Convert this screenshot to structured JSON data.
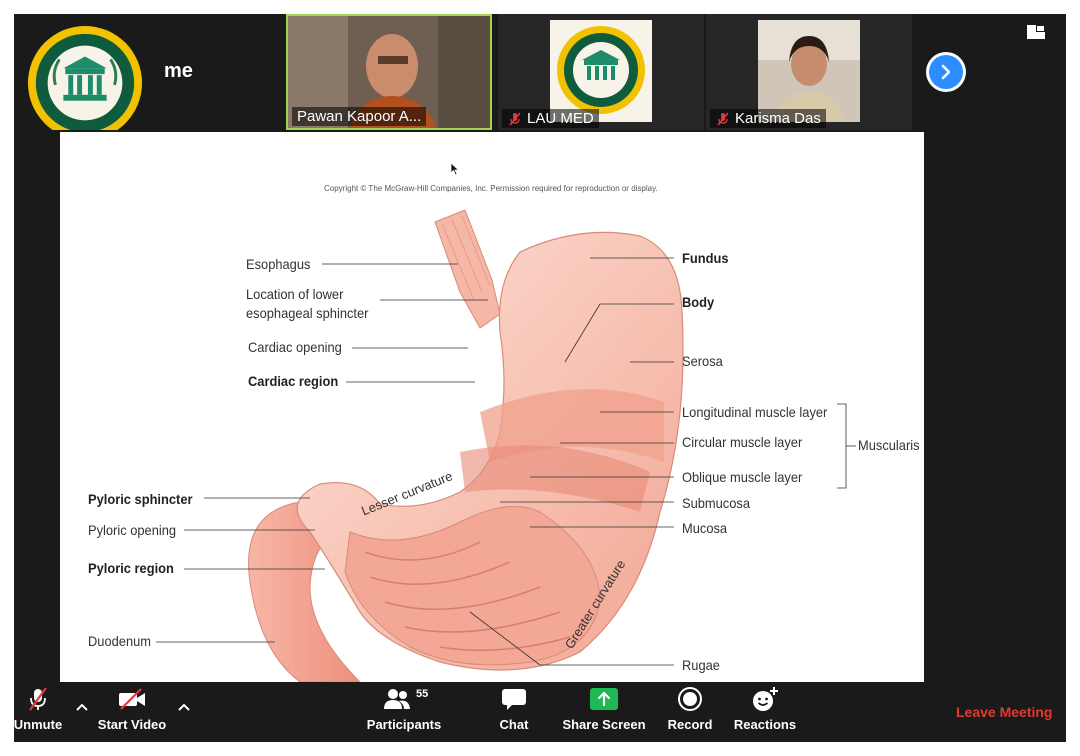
{
  "participants_strip": {
    "me": {
      "label": "me"
    },
    "tiles": [
      {
        "name": "Pawan Kapoor A...",
        "muted": false,
        "active_speaker": true
      },
      {
        "name": "LAU MED",
        "muted": true
      },
      {
        "name": "Karisma Das",
        "muted": true
      }
    ]
  },
  "shared_content": {
    "copyright": "Copyright © The McGraw-Hill Companies, Inc. Permission required for reproduction or display.",
    "labels_left": [
      {
        "text": "Esophagus",
        "bold": false
      },
      {
        "text": "Location of lower",
        "bold": false
      },
      {
        "text": "esophageal sphincter",
        "bold": false
      },
      {
        "text": "Cardiac opening",
        "bold": false
      },
      {
        "text": "Cardiac region",
        "bold": true
      },
      {
        "text": "Pyloric sphincter",
        "bold": true
      },
      {
        "text": "Pyloric opening",
        "bold": false
      },
      {
        "text": "Pyloric region",
        "bold": true
      },
      {
        "text": "Duodenum",
        "bold": false
      }
    ],
    "labels_right": [
      {
        "text": "Fundus",
        "bold": true
      },
      {
        "text": "Body",
        "bold": true
      },
      {
        "text": "Serosa",
        "bold": false
      },
      {
        "text": "Longitudinal muscle layer",
        "bold": false
      },
      {
        "text": "Circular muscle layer",
        "bold": false
      },
      {
        "text": "Oblique muscle layer",
        "bold": false
      },
      {
        "text": "Submucosa",
        "bold": false
      },
      {
        "text": "Mucosa",
        "bold": false
      },
      {
        "text": "Rugae",
        "bold": false
      }
    ],
    "muscularis": "Muscularis",
    "lesser_curvature": "Lesser curvature",
    "greater_curvature": "Greater curvature"
  },
  "toolbar": {
    "unmute": "Unmute",
    "start_video": "Start Video",
    "participants": "Participants",
    "participants_count": "55",
    "chat": "Chat",
    "share_screen": "Share Screen",
    "record": "Record",
    "reactions": "Reactions",
    "leave": "Leave Meeting"
  },
  "colors": {
    "active_speaker_border": "#a6d34a",
    "accent_blue": "#2d8cff",
    "share_green": "#1db954",
    "leave_red": "#e5392f",
    "muted_red": "#e0393b"
  },
  "icons": {
    "logo": "university-seal-icon",
    "next": "chevron-right-icon",
    "view": "gallery-view-icon"
  }
}
